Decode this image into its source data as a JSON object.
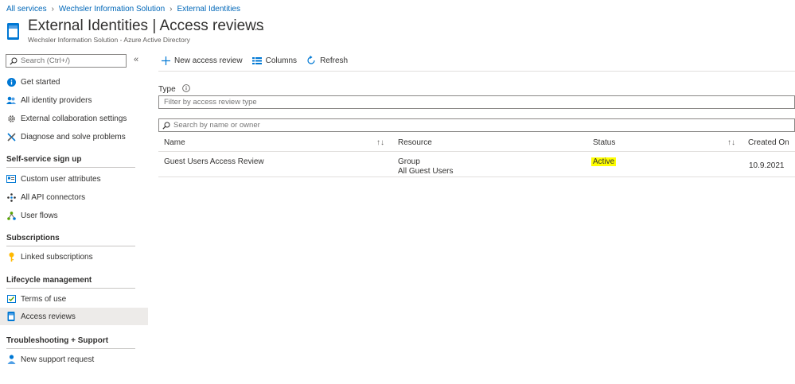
{
  "breadcrumb": [
    "All services",
    "Wechsler Information Solution",
    "External Identities"
  ],
  "header": {
    "title_part1": "External Identities",
    "title_sep": "|",
    "title_part2": "Access reviews",
    "subtitle": "Wechsler Information Solution - Azure Active Directory",
    "more": "..."
  },
  "sidebar": {
    "search_placeholder": "Search (Ctrl+/)",
    "collapse": "«",
    "groups": [
      {
        "items": [
          "Get started",
          "All identity providers",
          "External collaboration settings",
          "Diagnose and solve problems"
        ]
      },
      {
        "title": "Self-service sign up",
        "items": [
          "Custom user attributes",
          "All API connectors",
          "User flows"
        ]
      },
      {
        "title": "Subscriptions",
        "items": [
          "Linked subscriptions"
        ]
      },
      {
        "title": "Lifecycle management",
        "items": [
          "Terms of use",
          "Access reviews"
        ]
      },
      {
        "title": "Troubleshooting + Support",
        "items": [
          "New support request"
        ]
      }
    ],
    "active_item": "Access reviews"
  },
  "toolbar": {
    "new_access_review": "New access review",
    "columns": "Columns",
    "refresh": "Refresh"
  },
  "filter": {
    "type_label": "Type",
    "type_placeholder": "Filter by access review type",
    "search_placeholder": "Search by name or owner"
  },
  "table": {
    "columns": [
      "Name",
      "Resource",
      "Status",
      "Created On"
    ],
    "rows": [
      {
        "name": "Guest Users Access Review",
        "resource_type": "Group",
        "resource_name": "All Guest Users",
        "status": "Active",
        "created_on": "10.9.2021"
      }
    ]
  },
  "colors": {
    "link": "#0067b8",
    "status_highlight": "#ffff00",
    "active_nav_bg": "#edebe9"
  }
}
